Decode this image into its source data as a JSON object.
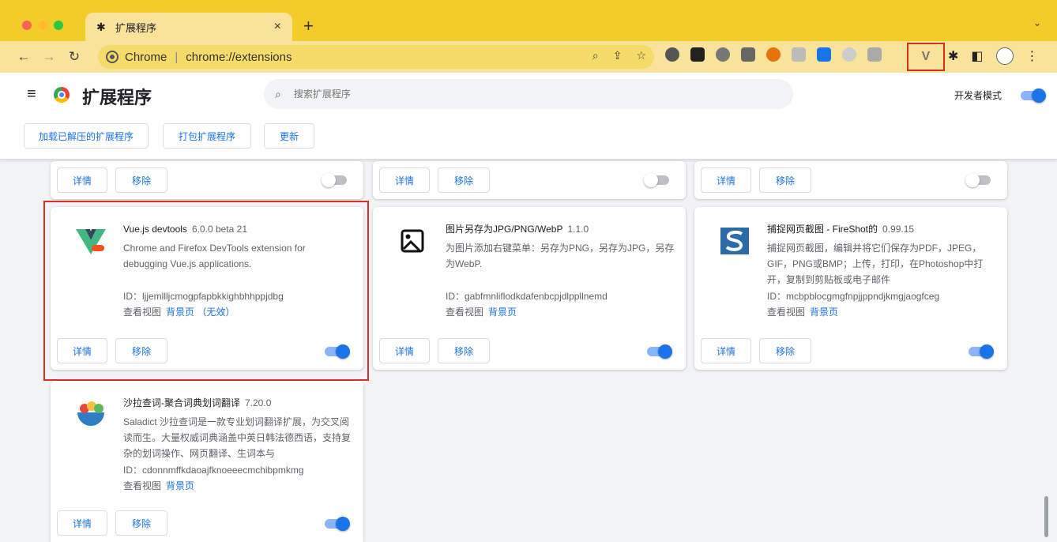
{
  "tab": {
    "title": "扩展程序",
    "close": "×",
    "new": "+"
  },
  "toolbar": {
    "site": "Chrome",
    "url": "chrome://extensions"
  },
  "header": {
    "title": "扩展程序",
    "search_placeholder": "搜索扩展程序",
    "dev_mode_label": "开发者模式"
  },
  "actions": {
    "load_unpacked": "加载已解压的扩展程序",
    "pack": "打包扩展程序",
    "update": "更新"
  },
  "card_buttons": {
    "details": "详情",
    "remove": "移除"
  },
  "extensions": [
    {
      "name": "Vue.js devtools",
      "version": "6.0.0 beta 21",
      "description": "Chrome and Firefox DevTools extension for debugging Vue.js applications.",
      "id": "ID：ljjemllljcmogpfapbkkighbhhppjdbg",
      "views_label": "查看视图",
      "view_link": "背景页 （无效）",
      "enabled": true
    },
    {
      "name": "图片另存为JPG/PNG/WebP",
      "version": "1.1.0",
      "description": "为图片添加右键菜单：另存为PNG，另存为JPG，另存为WebP.",
      "id": "ID：gabfmnliflodkdafenbcpjdlppllnemd",
      "views_label": "查看视图",
      "view_link": "背景页",
      "enabled": true
    },
    {
      "name": "捕捉网页截图 - FireShot的",
      "version": "0.99.15",
      "description": "捕捉网页截图，编辑并将它们保存为PDF，JPEG，GIF，PNG或BMP；上传，打印，在Photoshop中打开，复制到剪贴板或电子邮件",
      "id": "ID：mcbpblocgmgfnpjjppndjkmgjaogfceg",
      "views_label": "查看视图",
      "view_link": "背景页",
      "enabled": true
    },
    {
      "name": "沙拉查词-聚合词典划词翻译",
      "version": "7.20.0",
      "description": "Saladict 沙拉查词是一款专业划词翻译扩展，为交叉阅读而生。大量权威词典涵盖中英日韩法德西语，支持复杂的划词操作、网页翻译、生词本与",
      "id": "ID：cdonnmffkdaoajfknoeeecmchibpmkmg",
      "views_label": "查看视图",
      "view_link": "背景页",
      "enabled": true
    }
  ],
  "colors": {
    "accent": "#1a73e8",
    "tab_strip": "#f2cd29",
    "highlight": "#d93025"
  }
}
